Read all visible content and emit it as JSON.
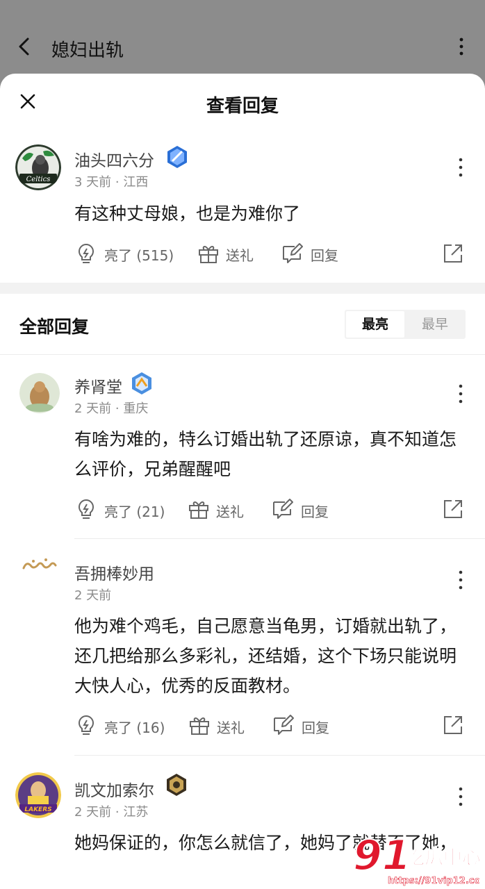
{
  "topbar": {
    "title": "媳妇出轨"
  },
  "sheet": {
    "title": "查看回复"
  },
  "main_comment": {
    "username": "油头四六分",
    "time": "3 天前",
    "location": "江西",
    "text": "有这种丈母娘，也是为难你了",
    "likes_label": "亮了 (515)",
    "gift_label": "送礼",
    "reply_label": "回复",
    "avatar_text": "Celtics"
  },
  "replies_header": {
    "title": "全部回复",
    "sort_active": "最亮",
    "sort_inactive": "最早"
  },
  "replies": [
    {
      "username": "养肾堂",
      "time": "2 天前",
      "location": "重庆",
      "text": "有啥为难的，特么订婚出轨了还原谅，真不知道怎么评价，兄弟醒醒吧",
      "likes_label": "亮了 (21)",
      "gift_label": "送礼",
      "reply_label": "回复"
    },
    {
      "username": "吾拥棒妙用",
      "time": "2 天前",
      "location": "",
      "text": "他为难个鸡毛，自己愿意当龟男，订婚就出轨了，还几把给那么多彩礼，还结婚，这个下场只能说明大快人心，优秀的反面教材。",
      "likes_label": "亮了 (16)",
      "gift_label": "送礼",
      "reply_label": "回复"
    },
    {
      "username": "凯文加索尔",
      "time": "2 天前",
      "location": "江苏",
      "text": "她妈保证的，你怎么就信了，她妈了就替不了她，",
      "avatar_text": "LAKERS"
    }
  ],
  "watermark": {
    "brand": "吃瓜中心",
    "url": "https://91vip12.com"
  },
  "colors": {
    "accent": "#1e6fd9",
    "watermark": "#e0182d"
  }
}
